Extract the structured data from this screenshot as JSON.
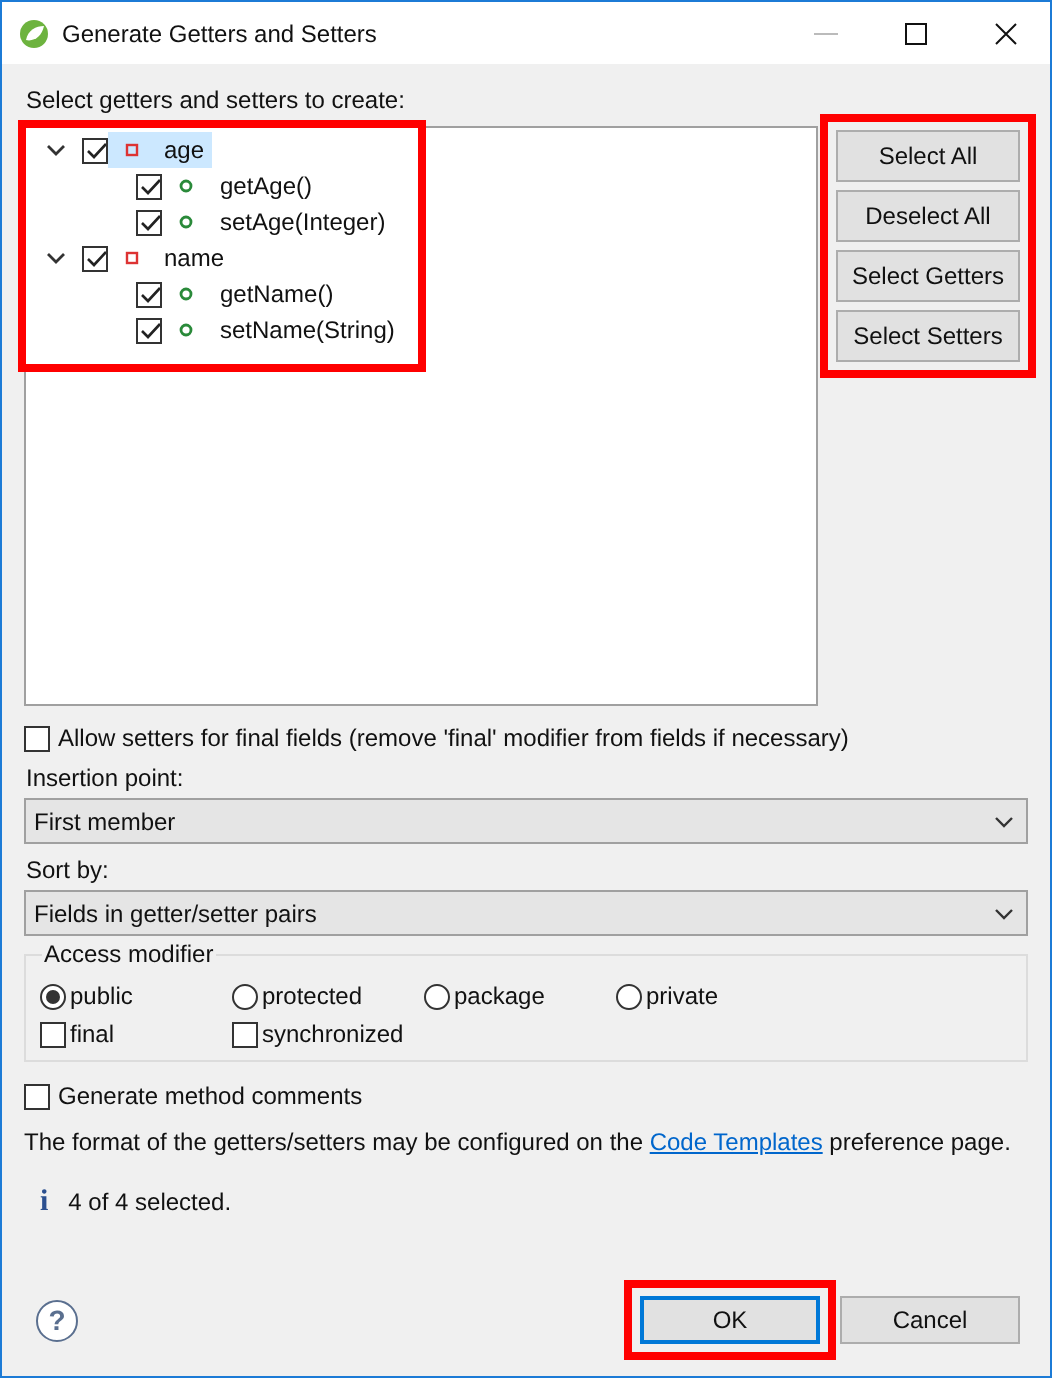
{
  "window": {
    "title": "Generate Getters and Setters"
  },
  "tree_label": "Select getters and setters to create:",
  "tree": {
    "highlighted": true,
    "items": [
      {
        "label": "age",
        "expanded": true,
        "checked": true,
        "selected": true,
        "children": [
          {
            "label": "getAge()",
            "checked": true,
            "selected": false
          },
          {
            "label": "setAge(Integer)",
            "checked": true,
            "selected": false
          }
        ]
      },
      {
        "label": "name",
        "expanded": true,
        "checked": true,
        "selected": false,
        "children": [
          {
            "label": "getName()",
            "checked": true,
            "selected": false
          },
          {
            "label": "setName(String)",
            "checked": true,
            "selected": false
          }
        ]
      }
    ]
  },
  "side_buttons": {
    "highlighted": true,
    "items": [
      "Select All",
      "Deselect All",
      "Select Getters",
      "Select Setters"
    ]
  },
  "allow_final": {
    "label": "Allow setters for final fields (remove 'final' modifier from fields if necessary)",
    "checked": false
  },
  "insertion_point": {
    "label": "Insertion point:",
    "value": "First member"
  },
  "sort_by": {
    "label": "Sort by:",
    "value": "Fields in getter/setter pairs"
  },
  "access_modifier": {
    "title": "Access modifier",
    "radios": [
      {
        "label": "public",
        "selected": true
      },
      {
        "label": "protected",
        "selected": false
      },
      {
        "label": "package",
        "selected": false
      },
      {
        "label": "private",
        "selected": false
      }
    ],
    "checks": [
      {
        "label": "final",
        "checked": false
      },
      {
        "label": "synchronized",
        "checked": false
      }
    ]
  },
  "method_comments": {
    "label": "Generate method comments",
    "checked": false
  },
  "format_note": {
    "before": "The format of the getters/setters may be configured on the",
    "link": "Code Templates",
    "after": "preference page."
  },
  "status": {
    "icon": "i",
    "text": "4 of 4 selected."
  },
  "help_icon": "?",
  "buttons": [
    {
      "label": "OK",
      "default": true,
      "highlighted": true
    },
    {
      "label": "Cancel",
      "default": false,
      "highlighted": false
    }
  ]
}
